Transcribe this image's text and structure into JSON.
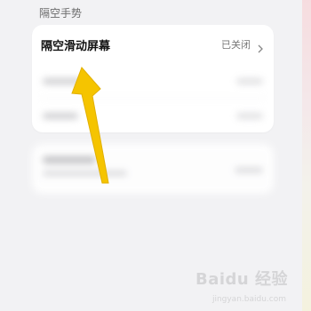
{
  "section": {
    "title": "隔空手势"
  },
  "setting_row": {
    "title": "隔空滑动屏幕",
    "value": "已关闭",
    "chevron_icon": "chevron-right-icon"
  },
  "annotation": {
    "arrow_color": "#f5c400",
    "arrow_icon": "annotation-arrow-icon"
  },
  "watermark": {
    "text": "Baidu 经验",
    "sub": "jingyan.baidu.com"
  }
}
